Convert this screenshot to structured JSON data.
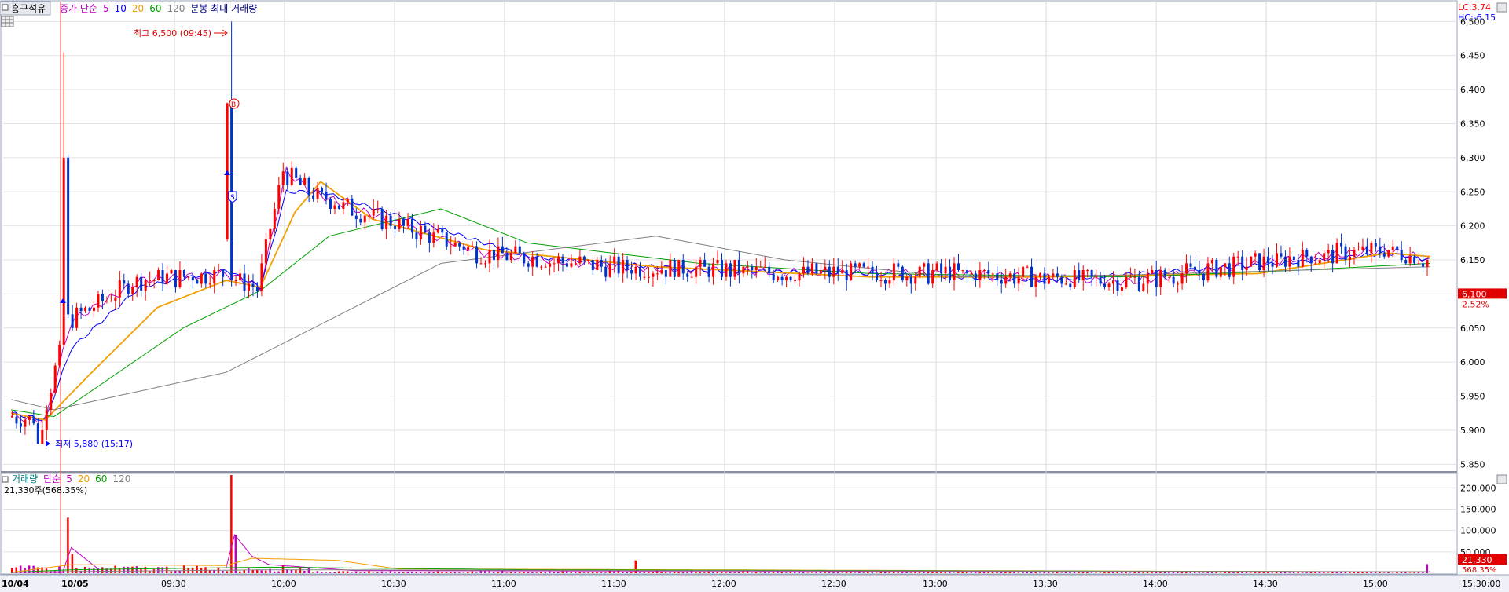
{
  "header": {
    "symbol": "흥구석유",
    "price_legend": [
      {
        "text": "종가 단순",
        "color": "#c000c0"
      },
      {
        "text": "5",
        "color": "#c000c0"
      },
      {
        "text": "10",
        "color": "#0000ff"
      },
      {
        "text": "20",
        "color": "#f0a000"
      },
      {
        "text": "60",
        "color": "#00a000"
      },
      {
        "text": "120",
        "color": "#808080"
      },
      {
        "text": "분봉 최대 거래량",
        "color": "#000080"
      }
    ],
    "lc_label": "LC:3.74",
    "hc_label": "HC:-6.15"
  },
  "annotations": {
    "high": "최고 6,500 (09:45)",
    "low": "최저 5,880 (15:17)",
    "buy_marker": "B",
    "sell_marker": "S"
  },
  "current_price": {
    "value": "6,100",
    "change": "2.52%",
    "price": 6100
  },
  "volume_panel": {
    "legend": [
      {
        "text": "거래량",
        "color": "#008080"
      },
      {
        "text": "단순",
        "color": "#c000c0"
      },
      {
        "text": "5",
        "color": "#c000c0"
      },
      {
        "text": "20",
        "color": "#f0a000"
      },
      {
        "text": "60",
        "color": "#00a000"
      },
      {
        "text": "120",
        "color": "#808080"
      }
    ],
    "current_volume_text": "21,330주(568.35%)",
    "current_volume_box": "21,330",
    "current_volume_pct": "568.35%"
  },
  "colors": {
    "up": "#ff0000",
    "down": "#0033cc",
    "ma5": "#c000c0",
    "ma10": "#0000ff",
    "ma20": "#f0a000",
    "ma60": "#00a000",
    "ma120": "#808080"
  },
  "chart_data": [
    {
      "type": "candlestick",
      "title": "",
      "x_labels": [
        "10/04",
        "10/05",
        "09:30",
        "10:00",
        "10:30",
        "11:00",
        "11:30",
        "12:00",
        "12:30",
        "13:00",
        "13:30",
        "14:00",
        "14:30",
        "15:00",
        "15:30:00"
      ],
      "y_ticks": [
        5850,
        5900,
        5950,
        6000,
        6050,
        6100,
        6150,
        6200,
        6250,
        6300,
        6350,
        6400,
        6450,
        6500
      ],
      "y_tick_labels": [
        "5,850",
        "5,900",
        "5,950",
        "6,000",
        "6,050",
        "6,100",
        "6,150",
        "6,200",
        "6,250",
        "6,300",
        "6,350",
        "6,400",
        "6,450",
        "6,500"
      ],
      "ylim": [
        5840,
        6520
      ],
      "high": 6500,
      "low": 5880,
      "series_names": [
        "5",
        "10",
        "20",
        "60",
        "120"
      ],
      "ma_series": [
        {
          "name": "5",
          "values": [
            [
              0,
              5920
            ],
            [
              8,
              5915
            ],
            [
              14,
              6060
            ],
            [
              30,
              6120
            ],
            [
              50,
              6130
            ],
            [
              58,
              6110
            ],
            [
              64,
              6280
            ],
            [
              70,
              6250
            ],
            [
              80,
              6225
            ],
            [
              110,
              6160
            ],
            [
              140,
              6140
            ],
            [
              180,
              6132
            ],
            [
              220,
              6130
            ],
            [
              260,
              6118
            ],
            [
              296,
              6150
            ],
            [
              320,
              6165
            ],
            [
              330,
              6150
            ]
          ]
        },
        {
          "name": "10",
          "values": [
            [
              0,
              5925
            ],
            [
              8,
              5915
            ],
            [
              14,
              6020
            ],
            [
              30,
              6110
            ],
            [
              50,
              6135
            ],
            [
              58,
              6110
            ],
            [
              64,
              6250
            ],
            [
              72,
              6250
            ],
            [
              90,
              6215
            ],
            [
              120,
              6155
            ],
            [
              160,
              6135
            ],
            [
              200,
              6130
            ],
            [
              240,
              6120
            ],
            [
              296,
              6145
            ],
            [
              320,
              6160
            ],
            [
              330,
              6150
            ]
          ]
        },
        {
          "name": "20",
          "values": [
            [
              0,
              5925
            ],
            [
              8,
              5915
            ],
            [
              18,
              5980
            ],
            [
              34,
              6080
            ],
            [
              50,
              6120
            ],
            [
              58,
              6110
            ],
            [
              66,
              6220
            ],
            [
              72,
              6265
            ],
            [
              84,
              6210
            ],
            [
              110,
              6165
            ],
            [
              150,
              6140
            ],
            [
              200,
              6125
            ],
            [
              240,
              6125
            ],
            [
              290,
              6130
            ],
            [
              320,
              6160
            ],
            [
              330,
              6155
            ]
          ]
        },
        {
          "name": "60",
          "values": [
            [
              0,
              5930
            ],
            [
              10,
              5920
            ],
            [
              40,
              6050
            ],
            [
              58,
              6105
            ],
            [
              74,
              6185
            ],
            [
              100,
              6225
            ],
            [
              120,
              6175
            ],
            [
              160,
              6145
            ],
            [
              200,
              6130
            ],
            [
              260,
              6125
            ],
            [
              300,
              6135
            ],
            [
              330,
              6145
            ]
          ]
        },
        {
          "name": "120",
          "values": [
            [
              0,
              5945
            ],
            [
              10,
              5930
            ],
            [
              50,
              5985
            ],
            [
              100,
              6145
            ],
            [
              150,
              6185
            ],
            [
              180,
              6150
            ],
            [
              220,
              6125
            ],
            [
              260,
              6128
            ],
            [
              300,
              6135
            ],
            [
              330,
              6140
            ]
          ]
        }
      ],
      "bar_count": 330
    },
    {
      "type": "bar",
      "title": "",
      "y_ticks": [
        50000,
        100000,
        150000,
        200000
      ],
      "y_tick_labels": [
        "50,000",
        "100,000",
        "150,000",
        "200,000"
      ],
      "ylim": [
        0,
        230000
      ],
      "peak_bars": [
        {
          "x": 13,
          "value": 130000
        },
        {
          "x": 14,
          "value": 45000
        },
        {
          "x": 51,
          "value": 230000
        },
        {
          "x": 52,
          "value": 90000
        },
        {
          "x": 145,
          "value": 30000
        },
        {
          "x": 329,
          "value": 21330
        }
      ],
      "series_names": [
        "5",
        "20",
        "60",
        "120"
      ]
    }
  ]
}
